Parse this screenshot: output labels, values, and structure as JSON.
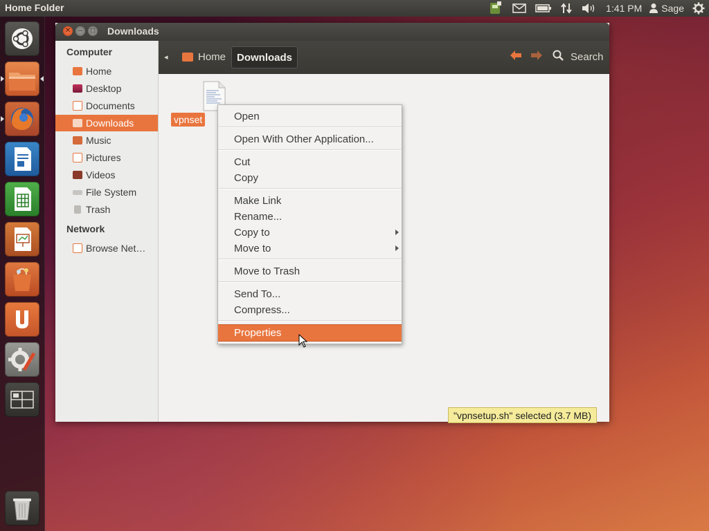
{
  "top_panel": {
    "title": "Home Folder",
    "clock": "1:41 PM",
    "user": "Sage",
    "icons": [
      "keyboard-layout-icon",
      "mail-icon",
      "battery-icon",
      "network-icon",
      "volume-icon",
      "user-icon",
      "gear-icon"
    ]
  },
  "launcher": {
    "items": [
      "ubuntu-dash-icon",
      "home-folder-icon",
      "firefox-icon",
      "writer-icon",
      "calc-icon",
      "impress-icon",
      "software-center-icon",
      "ubuntu-one-icon",
      "system-settings-icon",
      "workspace-switcher-icon",
      "trash-icon"
    ]
  },
  "window": {
    "title": "Downloads",
    "sidebar": {
      "computer_heading": "Computer",
      "items": [
        {
          "label": "Home",
          "icon": "home-icon"
        },
        {
          "label": "Desktop",
          "icon": "desktop-icon"
        },
        {
          "label": "Documents",
          "icon": "documents-icon"
        },
        {
          "label": "Downloads",
          "icon": "downloads-icon"
        },
        {
          "label": "Music",
          "icon": "music-icon"
        },
        {
          "label": "Pictures",
          "icon": "pictures-icon"
        },
        {
          "label": "Videos",
          "icon": "videos-icon"
        },
        {
          "label": "File System",
          "icon": "drive-icon"
        },
        {
          "label": "Trash",
          "icon": "trash-icon"
        }
      ],
      "network_heading": "Network",
      "network_items": [
        {
          "label": "Browse Net…",
          "icon": "network-icon"
        }
      ]
    },
    "toolbar": {
      "breadcrumb_home": "Home",
      "breadcrumb_current": "Downloads",
      "search_label": "Search"
    },
    "file": {
      "name_visible": "vpnset"
    },
    "status": "\"vpnsetup.sh\" selected (3.7 MB)"
  },
  "context_menu": {
    "open": "Open",
    "open_with": "Open With Other Application...",
    "cut": "Cut",
    "copy": "Copy",
    "make_link": "Make Link",
    "rename": "Rename...",
    "copy_to": "Copy to",
    "move_to": "Move to",
    "move_to_trash": "Move to Trash",
    "send_to": "Send To...",
    "compress": "Compress...",
    "properties": "Properties"
  },
  "colors": {
    "accent": "#e9753e",
    "panel": "#3c3b37",
    "window_bg": "#f2f1f0"
  }
}
